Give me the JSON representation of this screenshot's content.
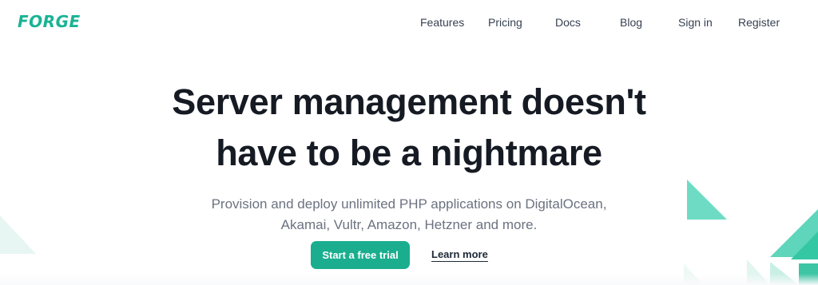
{
  "header": {
    "logo_text": "FORGE",
    "nav": [
      {
        "label": "Features"
      },
      {
        "label": "Pricing"
      },
      {
        "label": "Docs"
      },
      {
        "label": "Blog"
      },
      {
        "label": "Sign in"
      },
      {
        "label": "Register"
      }
    ]
  },
  "hero": {
    "headline_line1": "Server management doesn't",
    "headline_line2": "have to be a nightmare",
    "subtitle_line1": "Provision and deploy unlimited PHP applications on DigitalOcean,",
    "subtitle_line2": "Akamai, Vultr, Amazon, Hetzner and more.",
    "primary_cta": "Start a free trial",
    "secondary_cta": "Learn more"
  },
  "colors": {
    "brand": "#19b394",
    "button": "#1aae8f",
    "headline": "#151a23",
    "subtitle": "#6b7280",
    "decor_light": "#cdeee5",
    "decor_mid": "#7fdcc6",
    "decor_strong": "#3cc9a6"
  },
  "icons": {
    "decorative_shapes": "triangle-shapes"
  }
}
